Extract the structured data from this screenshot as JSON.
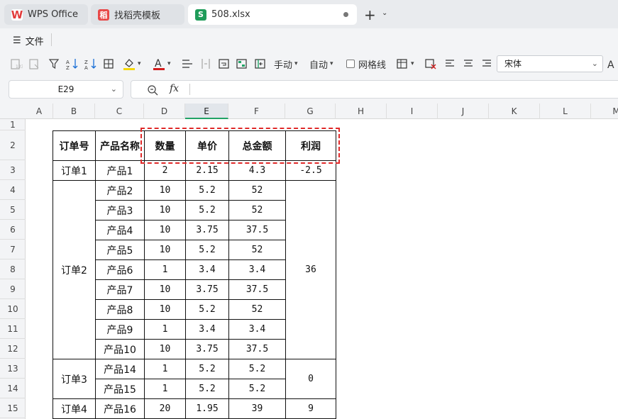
{
  "tabs": [
    {
      "label": "WPS Office",
      "icon": "wps-logo-icon"
    },
    {
      "label": "找稻壳模板",
      "icon": "daoke-icon"
    },
    {
      "label": "508.xlsx",
      "icon": "spreadsheet-icon",
      "active": true
    }
  ],
  "menu": {
    "file_label": "文件"
  },
  "toolbar": {
    "manual_label": "手动",
    "auto_label": "自动",
    "gridlines_label": "网格线",
    "font_name": "宋体"
  },
  "formula_bar": {
    "cell_ref": "E29",
    "fx_label": "fx",
    "value": ""
  },
  "columns": [
    "A",
    "B",
    "C",
    "D",
    "E",
    "F",
    "G",
    "H",
    "I",
    "J",
    "K",
    "L",
    "M"
  ],
  "selected_column": "E",
  "rows": [
    "1",
    "2",
    "3",
    "4",
    "5",
    "6",
    "7",
    "8",
    "9",
    "10",
    "11",
    "12",
    "13",
    "14",
    "15"
  ],
  "table": {
    "headers": [
      "订单号",
      "产品名称",
      "数量",
      "单价",
      "总金额",
      "利润"
    ],
    "orders": [
      {
        "order": "订单1",
        "profit": "-2.5",
        "items": [
          [
            "产品1",
            "2",
            "2.15",
            "4.3"
          ]
        ]
      },
      {
        "order": "订单2",
        "profit": "36",
        "items": [
          [
            "产品2",
            "10",
            "5.2",
            "52"
          ],
          [
            "产品3",
            "10",
            "5.2",
            "52"
          ],
          [
            "产品4",
            "10",
            "3.75",
            "37.5"
          ],
          [
            "产品5",
            "10",
            "5.2",
            "52"
          ],
          [
            "产品6",
            "1",
            "3.4",
            "3.4"
          ],
          [
            "产品7",
            "10",
            "3.75",
            "37.5"
          ],
          [
            "产品8",
            "10",
            "5.2",
            "52"
          ],
          [
            "产品9",
            "1",
            "3.4",
            "3.4"
          ],
          [
            "产品10",
            "10",
            "3.75",
            "37.5"
          ]
        ]
      },
      {
        "order": "订单3",
        "profit": "0",
        "items": [
          [
            "产品14",
            "1",
            "5.2",
            "5.2"
          ],
          [
            "产品15",
            "1",
            "5.2",
            "5.2"
          ]
        ]
      },
      {
        "order": "订单4",
        "profit": "9",
        "items": [
          [
            "产品16",
            "20",
            "1.95",
            "39"
          ]
        ]
      }
    ]
  },
  "colors": {
    "accent_green": "#21a366",
    "highlight_red": "#e02a2a"
  }
}
